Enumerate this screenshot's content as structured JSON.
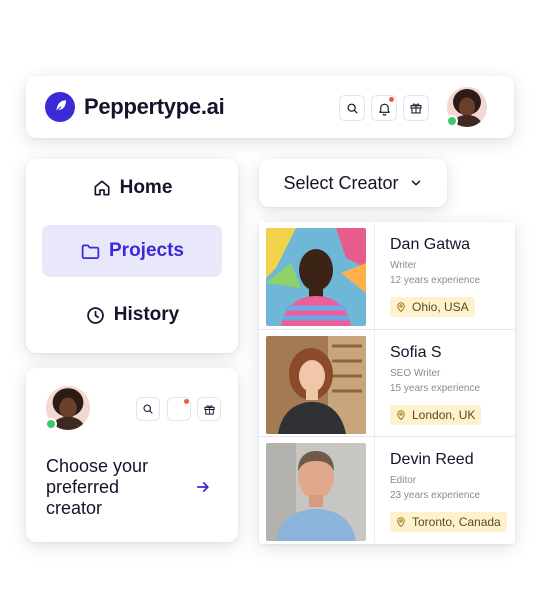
{
  "header": {
    "brand": "Peppertype.ai",
    "icons": [
      "feather-logo-icon",
      "search-icon",
      "bell-icon",
      "gift-icon"
    ]
  },
  "nav": {
    "items": [
      {
        "label": "Home",
        "icon": "home-icon",
        "active": false
      },
      {
        "label": "Projects",
        "icon": "folder-icon",
        "active": true
      },
      {
        "label": "History",
        "icon": "clock-icon",
        "active": false
      }
    ]
  },
  "choose_card": {
    "text": "Choose your preferred creator"
  },
  "select": {
    "label": "Select Creator"
  },
  "creators": [
    {
      "name": "Dan Gatwa",
      "role": "Writer",
      "experience": "12 years experience",
      "location": "Ohio, USA"
    },
    {
      "name": "Sofia S",
      "role": "SEO Writer",
      "experience": "15 years experience",
      "location": "London, UK"
    },
    {
      "name": "Devin Reed",
      "role": "Editor",
      "experience": "23 years experience",
      "location": "Toronto, Canada"
    }
  ],
  "colors": {
    "accent": "#3b2ad8",
    "accent_bg": "#e9e8fb",
    "online": "#3cc86c",
    "notification": "#ef5a3c",
    "location_bg": "#fdf2cc"
  }
}
